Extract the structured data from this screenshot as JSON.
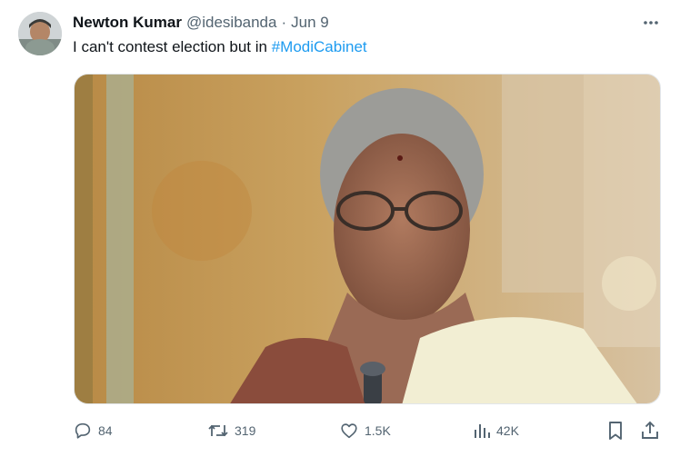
{
  "tweet": {
    "author_name": "Newton Kumar",
    "author_handle": "@idesibanda",
    "separator": "·",
    "date": "Jun 9",
    "text_prefix": "I can't contest election but in ",
    "hashtag": "#ModiCabinet"
  },
  "actions": {
    "replies": "84",
    "reposts": "319",
    "likes": "1.5K",
    "views": "42K"
  },
  "icons": {
    "more": "more-horizontal-icon",
    "reply": "reply-icon",
    "repost": "repost-icon",
    "like": "heart-icon",
    "views": "views-icon",
    "bookmark": "bookmark-icon",
    "share": "share-icon"
  },
  "colors": {
    "accent": "#1d9bf0",
    "text_primary": "#0f1419",
    "text_secondary": "#536471"
  }
}
